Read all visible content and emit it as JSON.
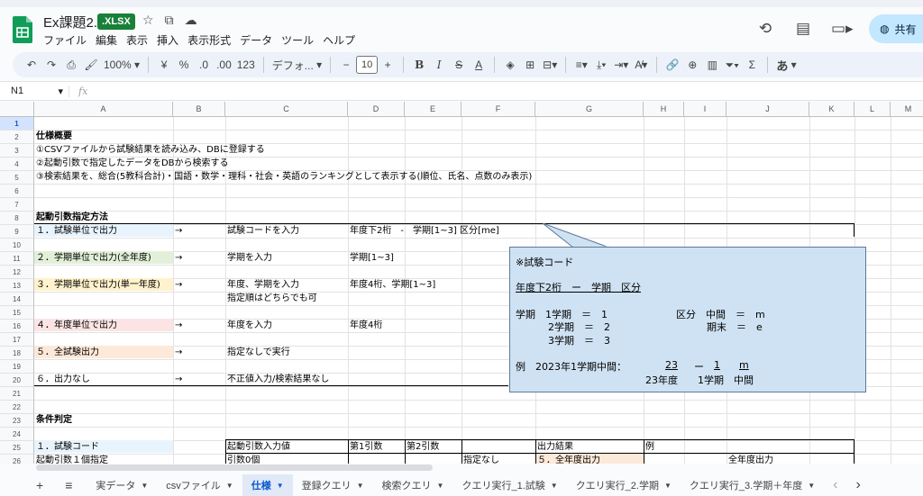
{
  "header": {
    "doc_title": "Ex課題2..",
    "badge": ".XLSX",
    "menu": [
      "ファイル",
      "編集",
      "表示",
      "挿入",
      "表示形式",
      "データ",
      "ツール",
      "ヘルプ"
    ],
    "share_label": "共有"
  },
  "toolbar": {
    "zoom": "100%",
    "currency": "¥",
    "percent": "%",
    "dec_decrease": ".0",
    "dec_increase": ".00",
    "number_format": "123",
    "font": "デフォ...",
    "font_size": "10",
    "minus": "−",
    "plus": "+",
    "input_tool": "あ"
  },
  "formula_bar": {
    "cell_ref": "N1",
    "fx": "fx"
  },
  "columns": [
    "A",
    "B",
    "C",
    "D",
    "E",
    "F",
    "G",
    "H",
    "I",
    "J",
    "K",
    "L",
    "M"
  ],
  "rows": [
    "1",
    "2",
    "3",
    "4",
    "5",
    "6",
    "7",
    "8",
    "9",
    "10",
    "11",
    "12",
    "13",
    "14",
    "15",
    "16",
    "17",
    "18",
    "19",
    "20",
    "21",
    "22",
    "23",
    "24",
    "25",
    "26"
  ],
  "cells": {
    "r2": "仕様概要",
    "r3": "①CSVファイルから試験結果を読み込み、DBに登録する",
    "r4": "②起動引数で指定したデータをDBから検索する",
    "r5": "③検索結果を、総合(5教科合計)・国語・数学・理科・社会・英語のランキングとして表示する(順位、氏名、点数のみ表示)",
    "r8": "起動引数指定方法",
    "r9a": "１．試験単位で出力",
    "r9b": "→",
    "r9c": "試験コードを入力",
    "r9d": "年度下2桁　-　学期[1~3]  区分[me]",
    "r11a": "２．学期単位で出力(全年度)",
    "r11b": "→",
    "r11c": "学期を入力",
    "r11d": "学期[1~3]",
    "r13a": "３．学期単位で出力(単一年度)",
    "r13b": "→",
    "r13c": "年度、学期を入力",
    "r13d": "年度4桁、学期[1~3]",
    "r14c": "指定順はどちらでも可",
    "r16a": "４．年度単位で出力",
    "r16b": "→",
    "r16c": "年度を入力",
    "r16d": "年度4桁",
    "r18a": "５．全試験出力",
    "r18b": "→",
    "r18c": "指定なしで実行",
    "r20a": "６．出力なし",
    "r20b": "→",
    "r20c": "不正値入力/検索結果なし",
    "r23": "条件判定",
    "r25a": "１．試験コード",
    "r25c": "起動引数入力値",
    "r25d": "第1引数",
    "r25e": "第2引数",
    "r25g": "出力結果",
    "r25h": "例",
    "r26a": "起動引数１個指定",
    "r26c": "引数0個",
    "r26f": "指定なし",
    "r26g": "５．全年度出力",
    "r26j": "全年度出力"
  },
  "callout": {
    "title": "※試験コード",
    "format": "年度下2桁　ー　学期　区分",
    "l1a": "学期　1学期　＝　1",
    "l1b": "区分　中間　＝　m",
    "l2a": "2学期　＝　2",
    "l2b": "期末　＝　e",
    "l3a": "3学期　＝　3",
    "ex_label": "例　2023年1学期中間：",
    "ex_23": "23",
    "ex_dash": "ー",
    "ex_1": "1",
    "ex_m": "m",
    "ex_sub": "23年度　　1学期　中間"
  },
  "tabs": {
    "add": "+",
    "all": "≡",
    "items": [
      "実データ",
      "csvファイル",
      "仕様",
      "登録クエリ",
      "検索クエリ",
      "クエリ実行_1.試験",
      "クエリ実行_2.学期",
      "クエリ実行_3.学期＋年度"
    ],
    "prev": "‹",
    "next": "›"
  },
  "colors": {
    "blue_fill": "#e8f4fd",
    "green_fill": "#e2f0d9",
    "yellow_fill": "#fff2cc",
    "pink_fill": "#fce4e4",
    "orange_fill": "#fde9d9",
    "callout_fill": "#cfe2f3",
    "badge": "#188038"
  }
}
